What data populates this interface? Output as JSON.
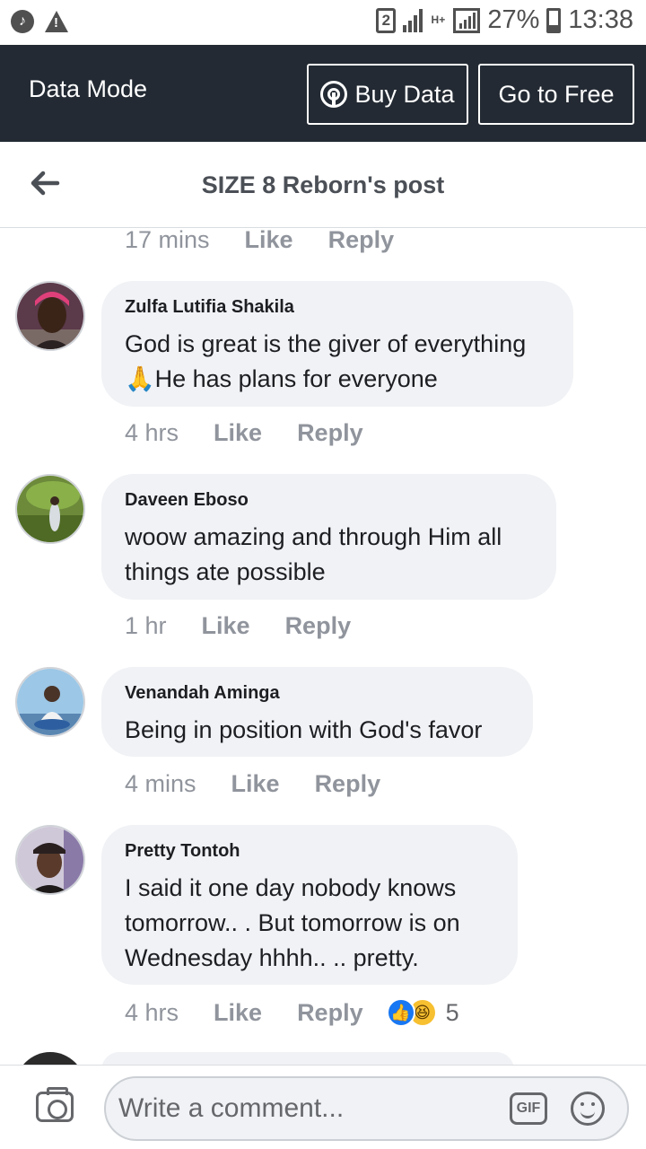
{
  "status_bar": {
    "sim_slot": "2",
    "network_type": "H+",
    "battery": "27%",
    "time": "13:38"
  },
  "data_mode": {
    "title": "Data Mode",
    "buy_label": "Buy Data",
    "free_label": "Go to Free"
  },
  "header": {
    "title": "SIZE 8 Reborn's post"
  },
  "actions": {
    "like": "Like",
    "reply": "Reply"
  },
  "previous_comment": {
    "time": "17 mins"
  },
  "comments": [
    {
      "author": "Zulfa Lutifia Shakila",
      "text_line1": "God is great is the giver of everything",
      "text_line2": "🙏He has plans for everyone",
      "time": "4 hrs"
    },
    {
      "author": "Daveen Eboso",
      "text_line1": "woow amazing and through Him all",
      "text_line2": "things ate possible",
      "time": "1 hr"
    },
    {
      "author": "Venandah Aminga",
      "text_line1": "Being in position with God's favor",
      "time": "4 mins"
    },
    {
      "author": "Pretty Tontoh",
      "text_line1": "I  said it one day nobody knows",
      "text_line2": "tomorrow.. . But tomorrow is on",
      "text_line3": "Wednesday hhhh.. .. pretty.",
      "time": "4 hrs",
      "reaction_count": "5"
    }
  ],
  "composer": {
    "placeholder": "Write a comment...",
    "gif_label": "GIF"
  },
  "icons": {
    "status_left": [
      "music-icon",
      "warning-icon"
    ],
    "data_buy": "antenna-icon",
    "header": "back-arrow-icon",
    "composer": [
      "camera-icon",
      "gif-icon",
      "emoji-icon"
    ],
    "reactions": [
      "like-reaction-icon",
      "haha-reaction-icon"
    ]
  }
}
